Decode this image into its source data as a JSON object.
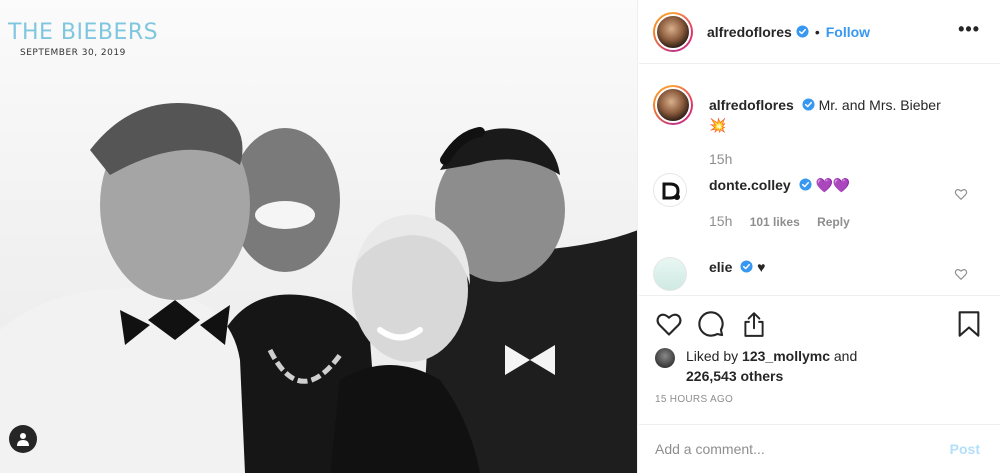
{
  "photo": {
    "overlay_title": "THE BIEBERS",
    "overlay_date": "SEPTEMBER 30, 2019",
    "tag_icon": "person-icon"
  },
  "header": {
    "username": "alfredoflores",
    "separator": "•",
    "follow_label": "Follow",
    "more_label": "•••"
  },
  "caption": {
    "username": "alfredoflores",
    "text": "Mr. and Mrs. Bieber",
    "emoji": "💥",
    "age": "15h"
  },
  "comments": [
    {
      "username": "donte.colley",
      "text": "💜💜",
      "age": "15h",
      "likes": "101 likes",
      "reply": "Reply"
    },
    {
      "username": "elie",
      "text": "♥"
    }
  ],
  "likes": {
    "prefix": "Liked by ",
    "user": "123_mollymc",
    "mid": " and",
    "others": "226,543 others"
  },
  "timestamp": "15 HOURS AGO",
  "comment_box": {
    "placeholder": "Add a comment...",
    "post_label": "Post"
  },
  "colors": {
    "accent": "#3897f0",
    "post_disabled": "#b2dffc",
    "muted": "#8e8e8e"
  }
}
